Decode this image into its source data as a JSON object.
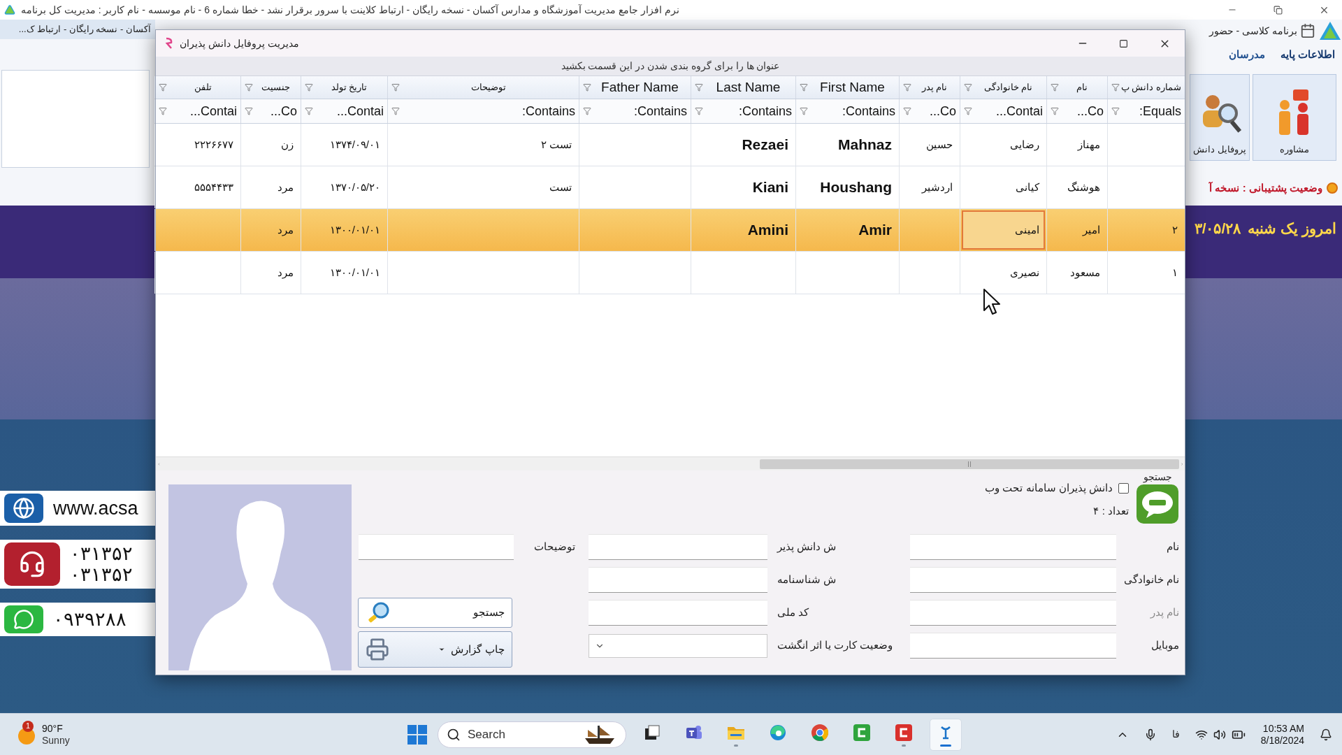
{
  "app_window": {
    "title": "نرم افزار جامع مدیریت آموزشگاه و مدارس آکسان - نسخه رایگان - ارتباط کلاینت با سرور برقرار نشد - خطا شماره 6 - نام موسسه - نام کاربر : مدیریت کل برنامه",
    "behind_title": "آکسان - نسخه رایگان - ارتباط ک...",
    "ribbon_tabs": [
      {
        "label": "برنامه کلاسی - حضور",
        "selected": false
      },
      {
        "label": "اطلاعات پایه",
        "selected": true
      },
      {
        "label": "مدرسان",
        "selected": false
      }
    ],
    "ribbon_buttons": [
      {
        "label": "مشاوره",
        "kind": "advice"
      },
      {
        "label": "پروفایل دانش",
        "kind": "profile"
      }
    ],
    "support_status": "وضعیت پشتیبانی : نسخه آ",
    "today": "امروز یک شنبه",
    "date": "۳/۰۵/۲۸",
    "contacts": [
      {
        "kind": "web",
        "lines": [
          "www.acsa"
        ]
      },
      {
        "kind": "phone",
        "lines": [
          "۰۳۱۳۵۲",
          "۰۳۱۳۵۲"
        ]
      },
      {
        "kind": "whatsapp",
        "lines": [
          "۰۹۳۹۲۸۸"
        ]
      }
    ]
  },
  "dialog": {
    "title": "مدیریت پروفایل دانش پذیران",
    "group_panel_hint": "عنوان ها را برای گروه بندی شدن در این قسمت بکشید",
    "columns": [
      {
        "header": "شماره دانش پ",
        "filter": "Equals:",
        "kind": "fa"
      },
      {
        "header": "نام",
        "filter": "Co...",
        "kind": "fa"
      },
      {
        "header": "نام خانوادگی",
        "filter": "Contai...",
        "kind": "fa"
      },
      {
        "header": "نام پدر",
        "filter": "Co...",
        "kind": "fa"
      },
      {
        "header": "First Name",
        "filter": "Contains:",
        "kind": "en"
      },
      {
        "header": "Last Name",
        "filter": "Contains:",
        "kind": "en"
      },
      {
        "header": "Father Name",
        "filter": "Contains:",
        "kind": "en"
      },
      {
        "header": "توضیحات",
        "filter": "Contains:",
        "kind": "fa"
      },
      {
        "header": "تاریخ تولد",
        "filter": "Contai...",
        "kind": "fa"
      },
      {
        "header": "جنسیت",
        "filter": "Co...",
        "kind": "fa"
      },
      {
        "header": "تلفن",
        "filter": "Contai...",
        "kind": "fa"
      }
    ],
    "rows": [
      {
        "selected": false,
        "cells": [
          {
            "focused": false
          },
          {
            "text": "مهناز",
            "focused": false
          },
          {
            "text": "رضایی",
            "focused": false
          },
          {
            "text": "حسین",
            "focused": false
          },
          {
            "text": "Mahnaz",
            "focused": false
          },
          {
            "text": "Rezaei",
            "focused": false
          },
          {
            "focused": false
          },
          {
            "text": "تست ۲",
            "focused": false
          },
          {
            "text": "۱۳۷۴/۰۹/۰۱",
            "focused": false
          },
          {
            "text": "زن",
            "focused": false
          },
          {
            "text": "۲۲۲۶۶۷۷",
            "focused": false
          }
        ]
      },
      {
        "selected": false,
        "cells": [
          {
            "focused": false
          },
          {
            "text": "هوشنگ",
            "focused": false
          },
          {
            "text": "کیانی",
            "focused": false
          },
          {
            "text": "اردشیر",
            "focused": false
          },
          {
            "text": "Houshang",
            "focused": false
          },
          {
            "text": "Kiani",
            "focused": false
          },
          {
            "focused": false
          },
          {
            "text": "تست",
            "focused": false
          },
          {
            "text": "۱۳۷۰/۰۵/۲۰",
            "focused": false
          },
          {
            "text": "مرد",
            "focused": false
          },
          {
            "text": "۵۵۵۴۴۳۳",
            "focused": false
          }
        ]
      },
      {
        "selected": true,
        "cells": [
          {
            "text": "۲",
            "focused": false
          },
          {
            "text": "امیر",
            "focused": false
          },
          {
            "text": "امینی",
            "focused": true
          },
          {
            "focused": false
          },
          {
            "text": "Amir",
            "focused": false
          },
          {
            "text": "Amini",
            "focused": false
          },
          {
            "focused": false
          },
          {
            "focused": false
          },
          {
            "text": "۱۳۰۰/۰۱/۰۱",
            "focused": false
          },
          {
            "text": "مرد",
            "focused": false
          },
          {
            "focused": false
          }
        ]
      },
      {
        "selected": false,
        "cells": [
          {
            "text": "۱",
            "focused": false
          },
          {
            "text": "مسعود",
            "focused": false
          },
          {
            "text": "نصیری",
            "focused": false
          },
          {
            "focused": false
          },
          {
            "focused": false
          },
          {
            "focused": false
          },
          {
            "focused": false
          },
          {
            "focused": false
          },
          {
            "text": "۱۳۰۰/۰۱/۰۱",
            "focused": false
          },
          {
            "text": "مرد",
            "focused": false
          },
          {
            "focused": false
          }
        ]
      }
    ],
    "form": {
      "search_label": "جستجو",
      "web_checkbox": {
        "label": "دانش پذیران سامانه تحت وب",
        "checked": false
      },
      "count": "تعداد : ۴",
      "fields_right": [
        {
          "label": "نام",
          "kind": "text",
          "disabled": false
        },
        {
          "label": "نام خانوادگی",
          "kind": "text",
          "disabled": false
        },
        {
          "label": "نام پدر",
          "kind": "text",
          "disabled": true
        },
        {
          "label": "موبایل",
          "kind": "text",
          "disabled": false
        }
      ],
      "fields_middle": [
        {
          "label": "ش دانش پذیر",
          "kind": "text",
          "disabled": false
        },
        {
          "label": "ش شناسنامه",
          "kind": "text",
          "disabled": false
        },
        {
          "label": "کد ملی",
          "kind": "text",
          "disabled": false
        },
        {
          "label": "وضعیت کارت یا اثر انگشت",
          "kind": "dropdown",
          "disabled": false
        }
      ],
      "fields_left": [
        {
          "label": "توضیحات",
          "kind": "text",
          "disabled": false
        }
      ],
      "buttons": [
        {
          "label": "جستجو",
          "kind": "search"
        },
        {
          "label": "چاپ گزارش",
          "kind": "print"
        }
      ]
    }
  },
  "taskbar": {
    "weather": {
      "temp": "90°F",
      "condition": "Sunny",
      "badge": "1"
    },
    "search_placeholder": "Search",
    "apps": [
      {
        "kind": "task-view",
        "running": false,
        "selected": false
      },
      {
        "kind": "teams",
        "running": false,
        "selected": false
      },
      {
        "kind": "explorer",
        "running": true,
        "selected": false
      },
      {
        "kind": "edge",
        "running": false,
        "selected": false
      },
      {
        "kind": "chrome",
        "running": false,
        "selected": false
      },
      {
        "kind": "green-app",
        "running": false,
        "selected": false
      },
      {
        "kind": "red-app",
        "running": true,
        "selected": false
      },
      {
        "kind": "school-app",
        "running": true,
        "selected": true
      }
    ],
    "language": "فا",
    "time": "10:53 AM",
    "date": "8/18/2024"
  }
}
